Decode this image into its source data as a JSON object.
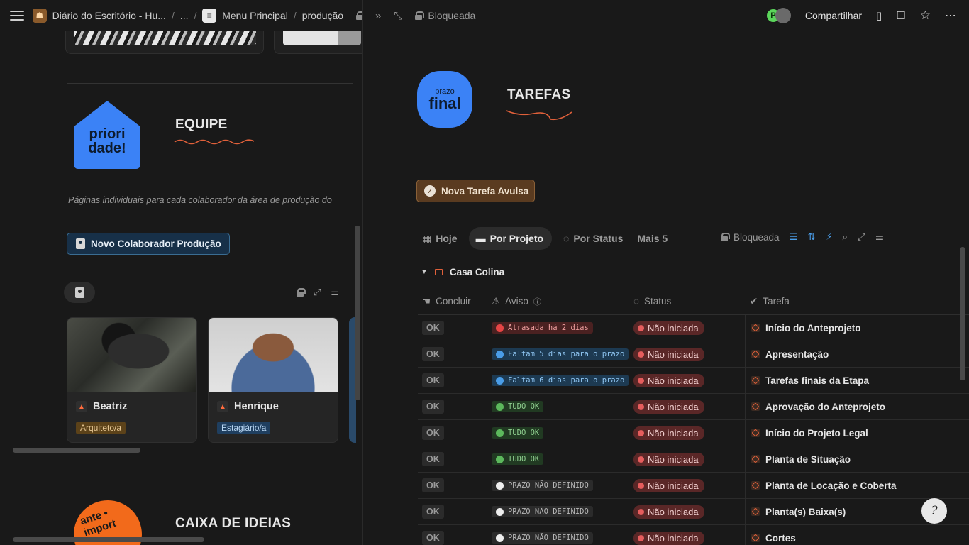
{
  "left_topbar": {
    "breadcrumb": [
      "Diário do Escritório - Hu...",
      "...",
      "Menu Principal",
      "produção"
    ]
  },
  "equipe": {
    "badge_text": "priori\ndade!",
    "title": "EQUIPE",
    "description": "Páginas individuais para cada colaborador da área de produção do",
    "new_button": "Novo Colaborador Produção",
    "cards": [
      {
        "name": "Beatriz",
        "role": "Arquiteto/a"
      },
      {
        "name": "Henrique",
        "role": "Estagiário/a"
      }
    ]
  },
  "ideias": {
    "badge_text": "ante • import",
    "title": "CAIXA DE IDEIAS"
  },
  "right_topbar": {
    "locked_label": "Bloqueada",
    "share_label": "Compartilhar",
    "avatar_letter": "P"
  },
  "tarefas": {
    "badge_small": "prazo",
    "badge_big": "final",
    "title": "TAREFAS",
    "new_button": "Nova Tarefa Avulsa",
    "tabs": [
      "Hoje",
      "Por Projeto",
      "Por Status",
      "Mais 5"
    ],
    "locked_label": "Bloqueada",
    "group_name": "Casa Colina",
    "columns": [
      "Concluir",
      "Aviso",
      "Status",
      "Tarefa"
    ],
    "rows": [
      {
        "concluir": "OK",
        "aviso": "Atrasada há 2 dias",
        "aviso_color": "red",
        "status": "Não iniciada",
        "tarefa": "Início do Anteprojeto"
      },
      {
        "concluir": "OK",
        "aviso": "Faltam 5 dias para o prazo",
        "aviso_color": "blue",
        "status": "Não iniciada",
        "tarefa": "Apresentação"
      },
      {
        "concluir": "OK",
        "aviso": "Faltam 6 dias para o prazo",
        "aviso_color": "blue",
        "status": "Não iniciada",
        "tarefa": "Tarefas finais da Etapa"
      },
      {
        "concluir": "OK",
        "aviso": "TUDO OK",
        "aviso_color": "green",
        "status": "Não iniciada",
        "tarefa": "Aprovação do Anteprojeto"
      },
      {
        "concluir": "OK",
        "aviso": "TUDO OK",
        "aviso_color": "green",
        "status": "Não iniciada",
        "tarefa": "Início do Projeto Legal"
      },
      {
        "concluir": "OK",
        "aviso": "TUDO OK",
        "aviso_color": "green",
        "status": "Não iniciada",
        "tarefa": "Planta de Situação"
      },
      {
        "concluir": "OK",
        "aviso": "PRAZO NÃO DEFINIDO",
        "aviso_color": "gray",
        "status": "Não iniciada",
        "tarefa": "Planta de Locação e Coberta"
      },
      {
        "concluir": "OK",
        "aviso": "PRAZO NÃO DEFINIDO",
        "aviso_color": "gray",
        "status": "Não iniciada",
        "tarefa": "Planta(s) Baixa(s)"
      },
      {
        "concluir": "OK",
        "aviso": "PRAZO NÃO DEFINIDO",
        "aviso_color": "gray",
        "status": "Não iniciada",
        "tarefa": "Cortes"
      }
    ]
  },
  "colors": {
    "brand_blue": "#3b82f6",
    "brand_orange": "#f26a1b",
    "status_red": "#e55d5d"
  }
}
